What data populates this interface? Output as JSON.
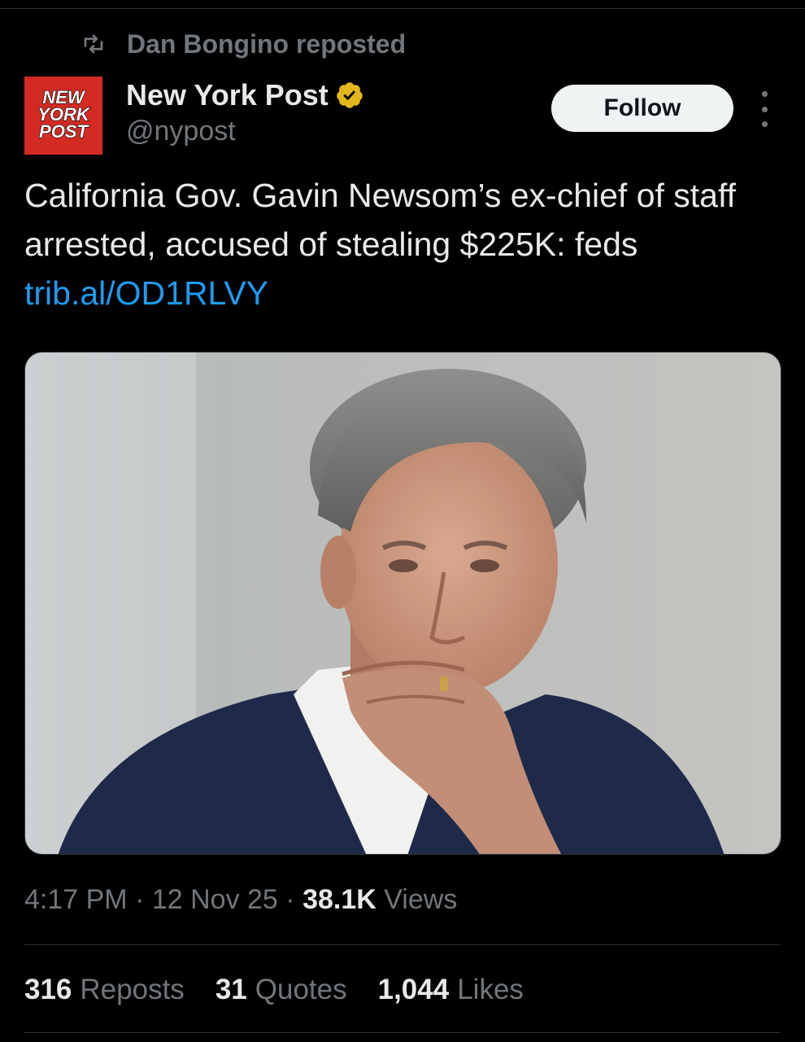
{
  "repost": {
    "text": "Dan Bongino reposted",
    "icon": "repost-icon"
  },
  "author": {
    "display_name": "New York Post",
    "handle": "@nypost",
    "verified_badge": "verified-gold-icon",
    "avatar_logo": "NEW YORK POST",
    "avatar_color": "#d32a24"
  },
  "follow_button": "Follow",
  "more_icon": "more-options-icon",
  "tweet": {
    "text": "California Gov. Gavin Newsom’s ex-chief of staff arrested, accused of stealing $225K: feds ",
    "link": "trib.al/OD1RLVY"
  },
  "meta": {
    "time": "4:17 PM",
    "sep1": " · ",
    "date": "12 Nov 25",
    "sep2": " · ",
    "views_count": "38.1K",
    "views_label": " Views"
  },
  "stats": {
    "reposts_count": "316",
    "reposts_label": "Reposts",
    "quotes_count": "31",
    "quotes_label": "Quotes",
    "likes_count": "1,044",
    "likes_label": "Likes"
  },
  "colors": {
    "background": "#000000",
    "text": "#e7e9ea",
    "muted": "#71767b",
    "link": "#1d9bf0",
    "verified": "#e2b719"
  }
}
